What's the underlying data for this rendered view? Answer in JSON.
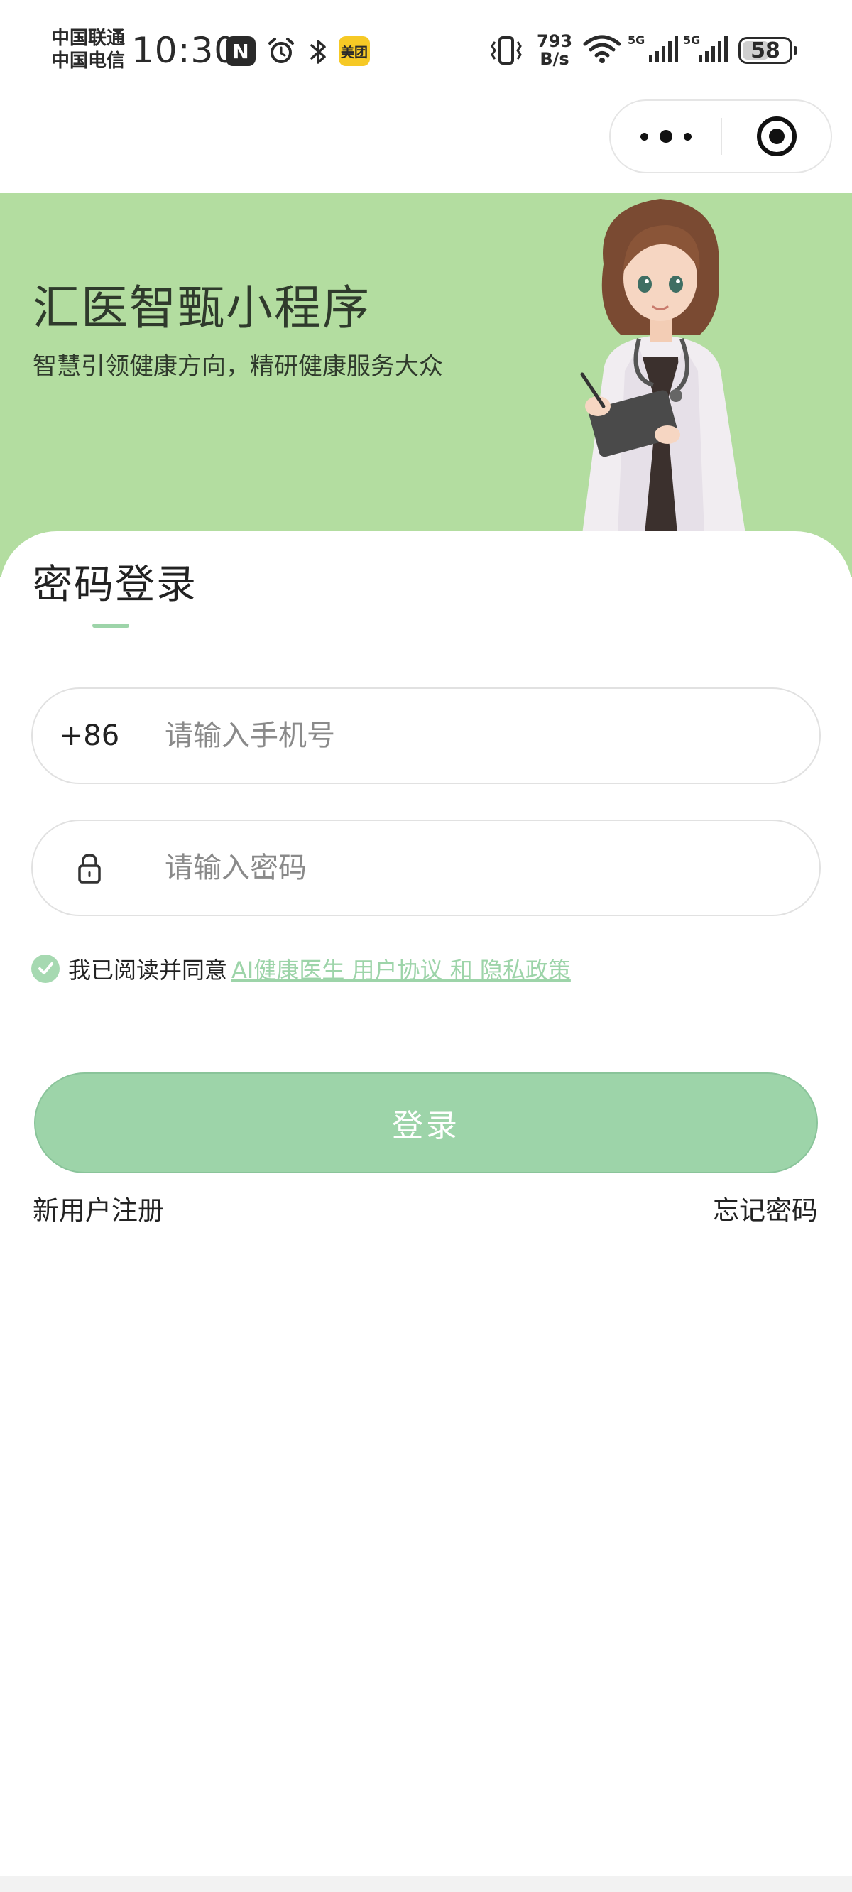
{
  "status_bar": {
    "carrier_1": "中国联通",
    "carrier_2": "中国电信",
    "time": "10:30",
    "nfc_label": "N",
    "meituan_badge": "美团",
    "net_speed_value": "793",
    "net_speed_unit": "B/s",
    "battery_level": "58",
    "icons": [
      "nfc-icon",
      "alarm-icon",
      "bluetooth-icon",
      "meituan-icon",
      "vibrate-icon",
      "wifi-icon",
      "signal-5g-icon",
      "signal-5g-icon",
      "battery-icon"
    ]
  },
  "capsule": {
    "icons": [
      "more-dots-icon",
      "close-target-icon"
    ]
  },
  "banner": {
    "title": "汇医智甄小程序",
    "slogan": "智慧引领健康方向，精研健康服务大众",
    "background": "#b3dda0"
  },
  "login": {
    "tab_title": "密码登录",
    "phone": {
      "prefix": "+86",
      "placeholder": "请输入手机号",
      "value": ""
    },
    "password": {
      "placeholder": "请输入密码",
      "value": "",
      "icon": "lock-icon"
    },
    "agreement": {
      "checked": true,
      "text": "我已阅读并同意",
      "link": "AI健康医生 用户协议 和 隐私政策"
    },
    "submit_label": "登录",
    "register_label": "新用户注册",
    "forgot_label": "忘记密码"
  },
  "colors": {
    "accent": "#9dd4a9",
    "banner": "#b3dda0",
    "text": "#222222"
  }
}
